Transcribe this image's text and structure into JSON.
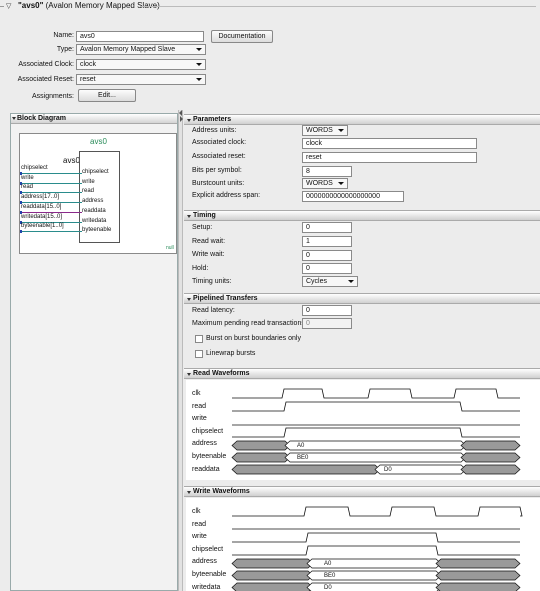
{
  "header": {
    "name": "\"avs0\"",
    "type_text": "(Avalon Memory Mapped Slave)"
  },
  "props": {
    "name_label": "Name:",
    "name_value": "avs0",
    "type_label": "Type:",
    "type_value": "Avalon Memory Mapped Slave",
    "clock_label": "Associated Clock:",
    "clock_value": "clock",
    "reset_label": "Associated Reset:",
    "reset_value": "reset",
    "assign_label": "Assignments:",
    "edit_button": "Edit...",
    "doc_button": "Documentation"
  },
  "block_diagram": {
    "title": "Block Diagram",
    "comp_title": "avs0",
    "comp_name": "avs0",
    "null_tag": "null",
    "ext_ports": [
      "chipselect",
      "write",
      "read",
      "address[17..0]",
      "readdata[15..0]",
      "writedata[15..0]",
      "byteenable[1..0]"
    ],
    "int_ports": [
      "chipselect",
      "write",
      "read",
      "address",
      "readdata",
      "writedata",
      "byteenable"
    ]
  },
  "parameters": {
    "title": "Parameters",
    "address_units_label": "Address units:",
    "address_units_value": "WORDS",
    "assoc_clock_label": "Associated clock:",
    "assoc_clock_value": "clock",
    "assoc_reset_label": "Associated reset:",
    "assoc_reset_value": "reset",
    "bits_label": "Bits per symbol:",
    "bits_value": "8",
    "burst_units_label": "Burstcount units:",
    "burst_units_value": "WORDS",
    "span_label": "Explicit address span:",
    "span_value": "0000000000000000000"
  },
  "timing": {
    "title": "Timing",
    "setup_label": "Setup:",
    "setup_value": "0",
    "read_wait_label": "Read wait:",
    "read_wait_value": "1",
    "write_wait_label": "Write wait:",
    "write_wait_value": "0",
    "hold_label": "Hold:",
    "hold_value": "0",
    "units_label": "Timing units:",
    "units_value": "Cycles"
  },
  "pipelined": {
    "title": "Pipelined Transfers",
    "latency_label": "Read latency:",
    "latency_value": "0",
    "max_pending_label": "Maximum pending read transactions:",
    "max_pending_value": "0",
    "burst_boundaries_label": "Burst on burst boundaries only",
    "linewrap_label": "Linewrap bursts"
  },
  "read_waveforms": {
    "title": "Read Waveforms",
    "signals": [
      "clk",
      "read",
      "write",
      "chipselect",
      "address",
      "byteenable",
      "readdata"
    ],
    "address_value": "A0",
    "byteenable_value": "BE0",
    "readdata_value": "D0"
  },
  "write_waveforms": {
    "title": "Write Waveforms",
    "signals": [
      "clk",
      "read",
      "write",
      "chipselect",
      "address",
      "byteenable",
      "writedata"
    ],
    "address_value": "A0",
    "byteenable_value": "BE0",
    "writedata_value": "D0"
  },
  "colors": {
    "accent_green": "#2a8c5a",
    "wave_gray": "#9a9a9a",
    "port_teal": "#2a8c8c"
  }
}
